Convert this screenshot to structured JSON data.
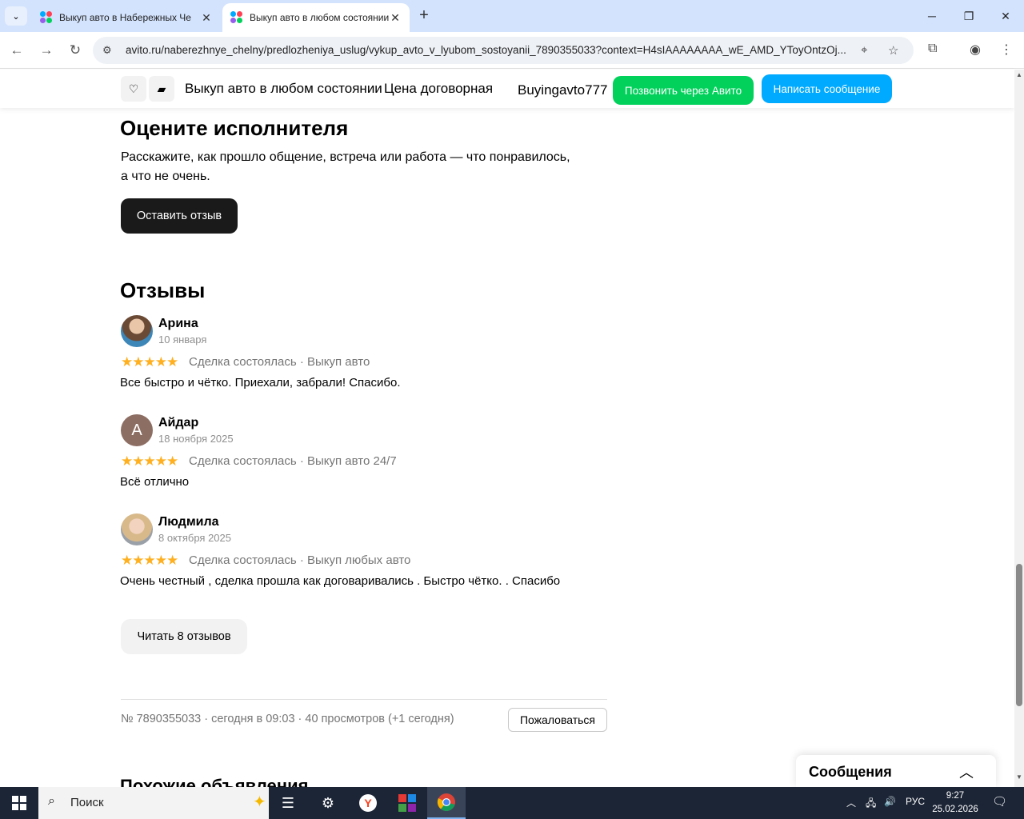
{
  "browser": {
    "tabs": [
      {
        "title": "Выкуп авто в Набережных Че",
        "active": false
      },
      {
        "title": "Выкуп авто в любом состоянии",
        "active": true
      }
    ],
    "url": "avito.ru/naberezhnye_chelny/predlozheniya_uslug/vykup_avto_v_lyubom_sostoyanii_7890355033?context=H4sIAAAAAAAA_wE_AMD_YToyOntzOj..."
  },
  "header": {
    "title": "Выкуп авто в любом состоянии",
    "price": "Цена договорная",
    "seller": "Buyingavto777",
    "call_button": "Позвонить через Авито",
    "message_button": "Написать сообщение"
  },
  "rate": {
    "heading": "Оцените исполнителя",
    "description_line1": "Расскажите, как прошло общение, встреча или работа — что понравилось,",
    "description_line2": "а что не очень.",
    "button": "Оставить отзыв"
  },
  "reviews": {
    "heading": "Отзывы",
    "items": [
      {
        "name": "Арина",
        "date": "10 января",
        "stars": "★★★★★",
        "meta": "Сделка состоялась · Выкуп авто",
        "text": "Все быстро и чётко. Приехали, забрали! Спасибо.",
        "avatar_letter": ""
      },
      {
        "name": "Айдар",
        "date": "18 ноября 2025",
        "stars": "★★★★★",
        "meta": "Сделка состоялась · Выкуп авто 24/7",
        "text": "Всё отлично",
        "avatar_letter": "А"
      },
      {
        "name": "Людмила",
        "date": "8 октября 2025",
        "stars": "★★★★★",
        "meta": "Сделка состоялась · Выкуп любых авто",
        "text": "Очень честный , сделка прошла как договаривались . Быстро чётко. . Спасибо",
        "avatar_letter": ""
      }
    ],
    "more_button": "Читать 8 отзывов"
  },
  "ad_info": {
    "meta": "№ 7890355033 · сегодня в 09:03 · 40 просмотров (+1 сегодня)",
    "report_button": "Пожаловаться"
  },
  "similar_heading": "Похожие объявления",
  "messages_widget": {
    "title": "Сообщения"
  },
  "taskbar": {
    "search_label": "Поиск",
    "lang": "РУС",
    "time": "9:27",
    "date": "25.02.2026"
  },
  "colors": {
    "call_green": "#02d15c",
    "message_blue": "#00aaff",
    "star": "#ffb021",
    "tabstrip": "#d3e3fd"
  }
}
